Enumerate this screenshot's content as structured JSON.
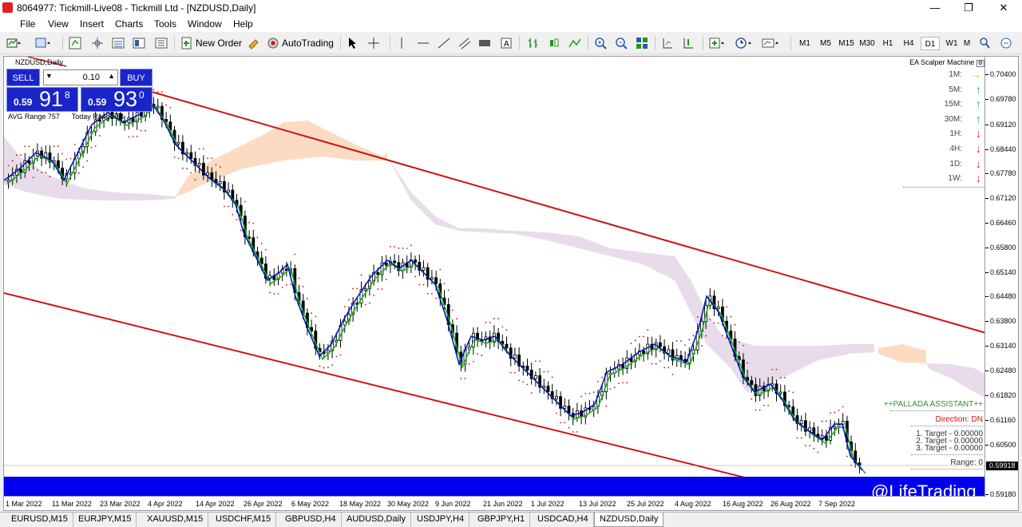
{
  "window": {
    "title": "8064977: Tickmill-Live08 - Tickmill Ltd - [NZDUSD,Daily]",
    "minimize": "—",
    "restore": "❐",
    "close": "✕"
  },
  "menu": [
    "File",
    "View",
    "Insert",
    "Charts",
    "Tools",
    "Window",
    "Help"
  ],
  "toolbar": {
    "new_order": "New Order",
    "auto_trading": "AutoTrading",
    "timeframes": [
      "M1",
      "M5",
      "M15",
      "M30",
      "H1",
      "H4",
      "D1",
      "W1",
      "M"
    ],
    "active_timeframe": "D1"
  },
  "chart": {
    "symbol_label": "NZDUSD,Daily",
    "trade_panel": {
      "sell_label": "SELL",
      "buy_label": "BUY",
      "lot": "0.10",
      "sell_small": "0.59",
      "sell_big": "91",
      "sell_sup": "8",
      "buy_small": "0.59",
      "buy_big": "93",
      "buy_sup": "0",
      "avg_range": "AVG Range 757",
      "today_range": "Today Range 54"
    },
    "ea": {
      "title": "EA Scalper Machine",
      "rows": [
        {
          "tf": "1M:",
          "dir": "right",
          "color": "#e8c020"
        },
        {
          "tf": "5M:",
          "dir": "up",
          "color": "#1e88e5"
        },
        {
          "tf": "15M:",
          "dir": "up",
          "color": "#1e88e5"
        },
        {
          "tf": "30M:",
          "dir": "up",
          "color": "#1e88e5"
        },
        {
          "tf": "1H:",
          "dir": "down",
          "color": "#d32020"
        },
        {
          "tf": "4H:",
          "dir": "down",
          "color": "#d32020"
        },
        {
          "tf": "1D:",
          "dir": "down",
          "color": "#d32020"
        },
        {
          "tf": "1W:",
          "dir": "down",
          "color": "#d32020"
        }
      ]
    },
    "pallada": {
      "title": "++PALLADA ASSISTANT++",
      "direction": "Direction: DN",
      "t1": "1. Target - 0.00000",
      "t2": "2. Target - 0.00000",
      "t3": "3. Target - 0.00000",
      "range": "Range: 0"
    },
    "price_labels": [
      "0.70400",
      "0.69780",
      "0.69120",
      "0.68440",
      "0.67780",
      "0.67120",
      "0.66460",
      "0.65800",
      "0.65140",
      "0.64480",
      "0.63800",
      "0.63140",
      "0.62480",
      "0.61820",
      "0.61160",
      "0.60500",
      "0.59918",
      "0.59180"
    ],
    "current_price": "0.59918",
    "date_labels": [
      "1 Mar 2022",
      "11 Mar 2022",
      "23 Mar 2022",
      "4 Apr 2022",
      "14 Apr 2022",
      "26 Apr 2022",
      "6 May 2022",
      "18 May 2022",
      "30 May 2022",
      "9 Jun 2022",
      "21 Jun 2022",
      "1 Jul 2022",
      "13 Jul 2022",
      "25 Jul 2022",
      "4 Aug 2022",
      "16 Aug 2022",
      "26 Aug 2022",
      "7 Sep 2022"
    ],
    "watermark": "@LifeTrading",
    "colors": {
      "channel": "#d01010",
      "cloud_bear": "#e8dcea",
      "cloud_bull": "#fbdcc3",
      "ma_fast": "#0010c0",
      "ma_slow": "#10b010",
      "bluebar": "#0000ee"
    }
  },
  "tabs": [
    "EURUSD,M15",
    "EURJPY,M15",
    "XAUUSD,M15",
    "USDCHF,M15",
    "GBPUSD,H4",
    "AUDUSD,Daily",
    "USDJPY,H4",
    "GBPJPY,H1",
    "USDCAD,H4",
    "NZDUSD,Daily"
  ],
  "active_tab": "NZDUSD,Daily"
}
